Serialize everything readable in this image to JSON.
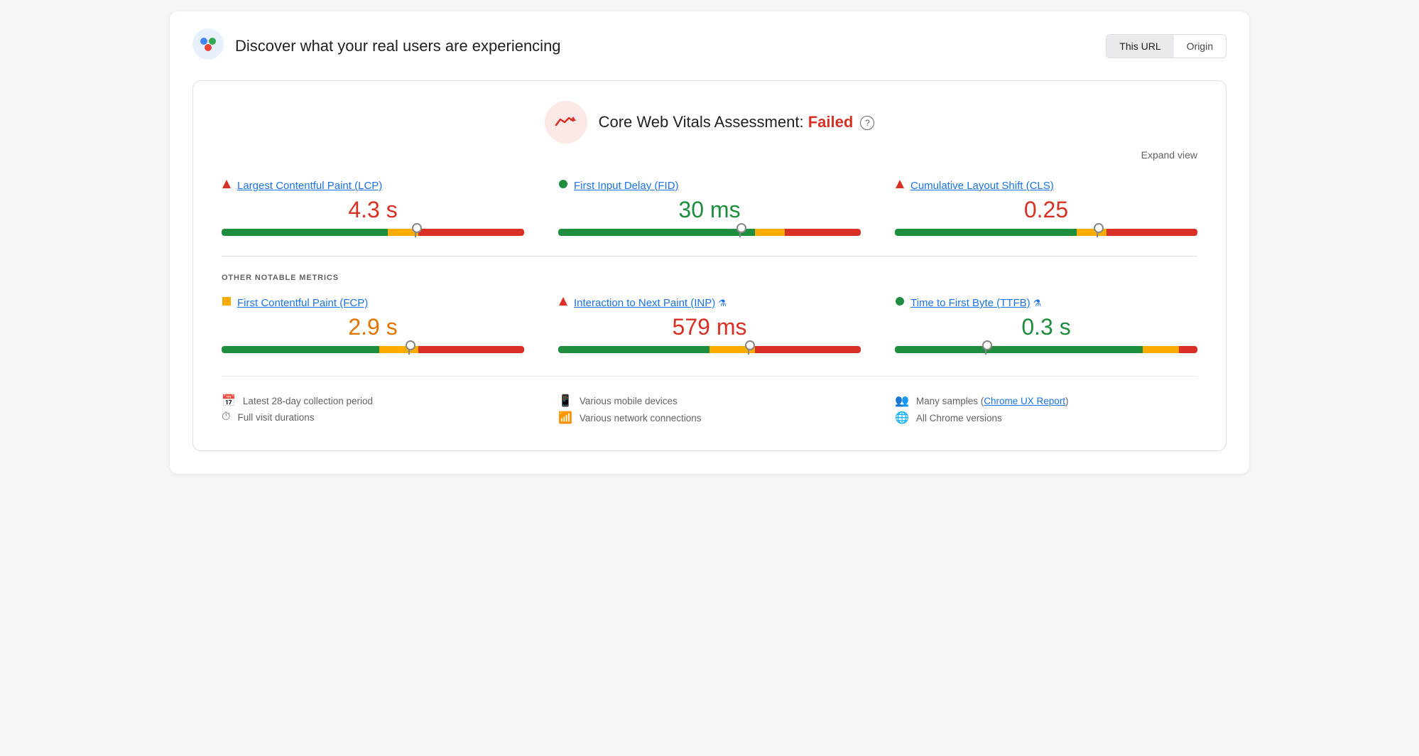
{
  "header": {
    "title": "Discover what your real users are experiencing",
    "url_btn": "This URL",
    "origin_btn": "Origin"
  },
  "assessment": {
    "title": "Core Web Vitals Assessment:",
    "status": "Failed",
    "expand": "Expand view",
    "help": "?"
  },
  "core_metrics": [
    {
      "id": "lcp",
      "indicator": "triangle",
      "indicator_color": "#d93025",
      "name": "Largest Contentful Paint (LCP)",
      "value": "4.3 s",
      "value_color": "red",
      "bar": {
        "green": 55,
        "orange": 10,
        "red": 35,
        "marker": 64
      }
    },
    {
      "id": "fid",
      "indicator": "circle",
      "indicator_color": "#1e8e3e",
      "name": "First Input Delay (FID)",
      "value": "30 ms",
      "value_color": "green",
      "bar": {
        "green": 65,
        "orange": 10,
        "red": 25,
        "marker": 60
      }
    },
    {
      "id": "cls",
      "indicator": "triangle",
      "indicator_color": "#d93025",
      "name": "Cumulative Layout Shift (CLS)",
      "value": "0.25",
      "value_color": "red",
      "bar": {
        "green": 60,
        "orange": 10,
        "red": 30,
        "marker": 67
      }
    }
  ],
  "other_metrics_label": "OTHER NOTABLE METRICS",
  "other_metrics": [
    {
      "id": "fcp",
      "indicator": "square",
      "indicator_color": "#f9ab00",
      "name": "First Contentful Paint (FCP)",
      "value": "2.9 s",
      "value_color": "orange",
      "flask": false,
      "bar": {
        "green": 52,
        "orange": 13,
        "red": 35,
        "marker": 62
      }
    },
    {
      "id": "inp",
      "indicator": "triangle",
      "indicator_color": "#d93025",
      "name": "Interaction to Next Paint (INP)",
      "value": "579 ms",
      "value_color": "red",
      "flask": true,
      "bar": {
        "green": 50,
        "orange": 15,
        "red": 35,
        "marker": 63
      }
    },
    {
      "id": "ttfb",
      "indicator": "circle",
      "indicator_color": "#1e8e3e",
      "name": "Time to First Byte (TTFB)",
      "value": "0.3 s",
      "value_color": "green",
      "flask": true,
      "bar": {
        "green": 82,
        "orange": 12,
        "red": 6,
        "marker": 30
      }
    }
  ],
  "footer": {
    "col1": [
      {
        "icon": "📅",
        "text": "Latest 28-day collection period"
      },
      {
        "icon": "⏱",
        "text": "Full visit durations"
      }
    ],
    "col2": [
      {
        "icon": "📱",
        "text": "Various mobile devices"
      },
      {
        "icon": "📶",
        "text": "Various network connections"
      }
    ],
    "col3": [
      {
        "icon": "👥",
        "text": "Many samples (",
        "link": "Chrome UX Report",
        "text_after": ")"
      },
      {
        "icon": "🌐",
        "text": "All Chrome versions"
      }
    ]
  }
}
